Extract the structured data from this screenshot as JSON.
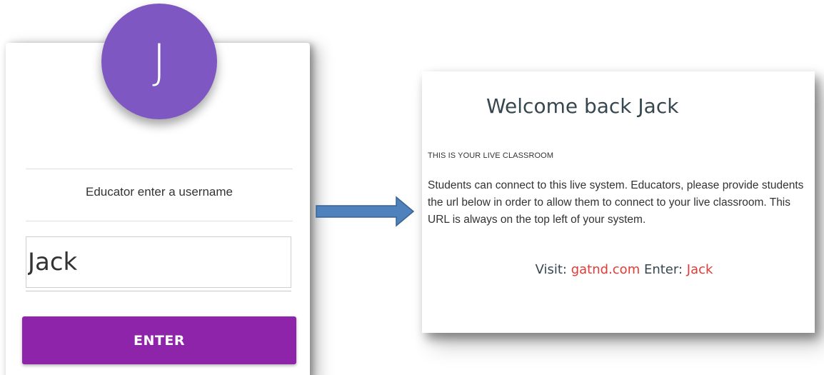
{
  "login_card": {
    "avatar_initial": "J",
    "prompt": "Educator enter a username",
    "username_value": "Jack",
    "enter_label": "ENTER"
  },
  "arrow": {
    "icon": "right-arrow-icon",
    "color": "#4f81bd"
  },
  "welcome_card": {
    "title": "Welcome back Jack",
    "section_heading": "THIS IS YOUR LIVE CLASSROOM",
    "description": "Students can connect to this live system. Educators, please provide students the url below in order to allow them to connect to your live classroom. This URL is always on the top left of your system.",
    "visit_label": "Visit:",
    "visit_url": "gatnd.com",
    "enter_label": "Enter:",
    "enter_value": "Jack"
  },
  "colors": {
    "avatar": "#7e57c2",
    "button": "#8e24aa",
    "link": "#e53935"
  }
}
